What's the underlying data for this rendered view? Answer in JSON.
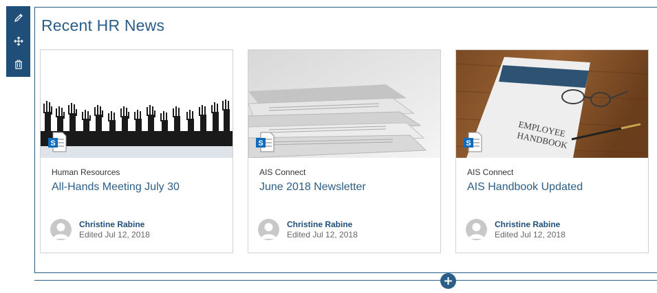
{
  "section": {
    "title": "Recent HR News"
  },
  "toolbar": {
    "icons": [
      "pencil-icon",
      "move-icon",
      "trash-icon"
    ]
  },
  "cards": [
    {
      "category": "Human Resources",
      "title": "All-Hands Meeting July 30",
      "author": "Christine Rabine",
      "edited": "Edited Jul 12, 2018",
      "image": "raised-hands-silhouette"
    },
    {
      "category": "AIS Connect",
      "title": "June 2018 Newsletter",
      "author": "Christine Rabine",
      "edited": "Edited Jul 12, 2018",
      "image": "newspaper-stack"
    },
    {
      "category": "AIS Connect",
      "title": "AIS Handbook Updated",
      "author": "Christine Rabine",
      "edited": "Edited Jul 12, 2018",
      "image": "employee-handbook",
      "image_text": [
        "EMPLOYEE",
        "HANDBOOK"
      ]
    }
  ],
  "colors": {
    "accent": "#2b5d86",
    "toolbar": "#1f4e79"
  }
}
